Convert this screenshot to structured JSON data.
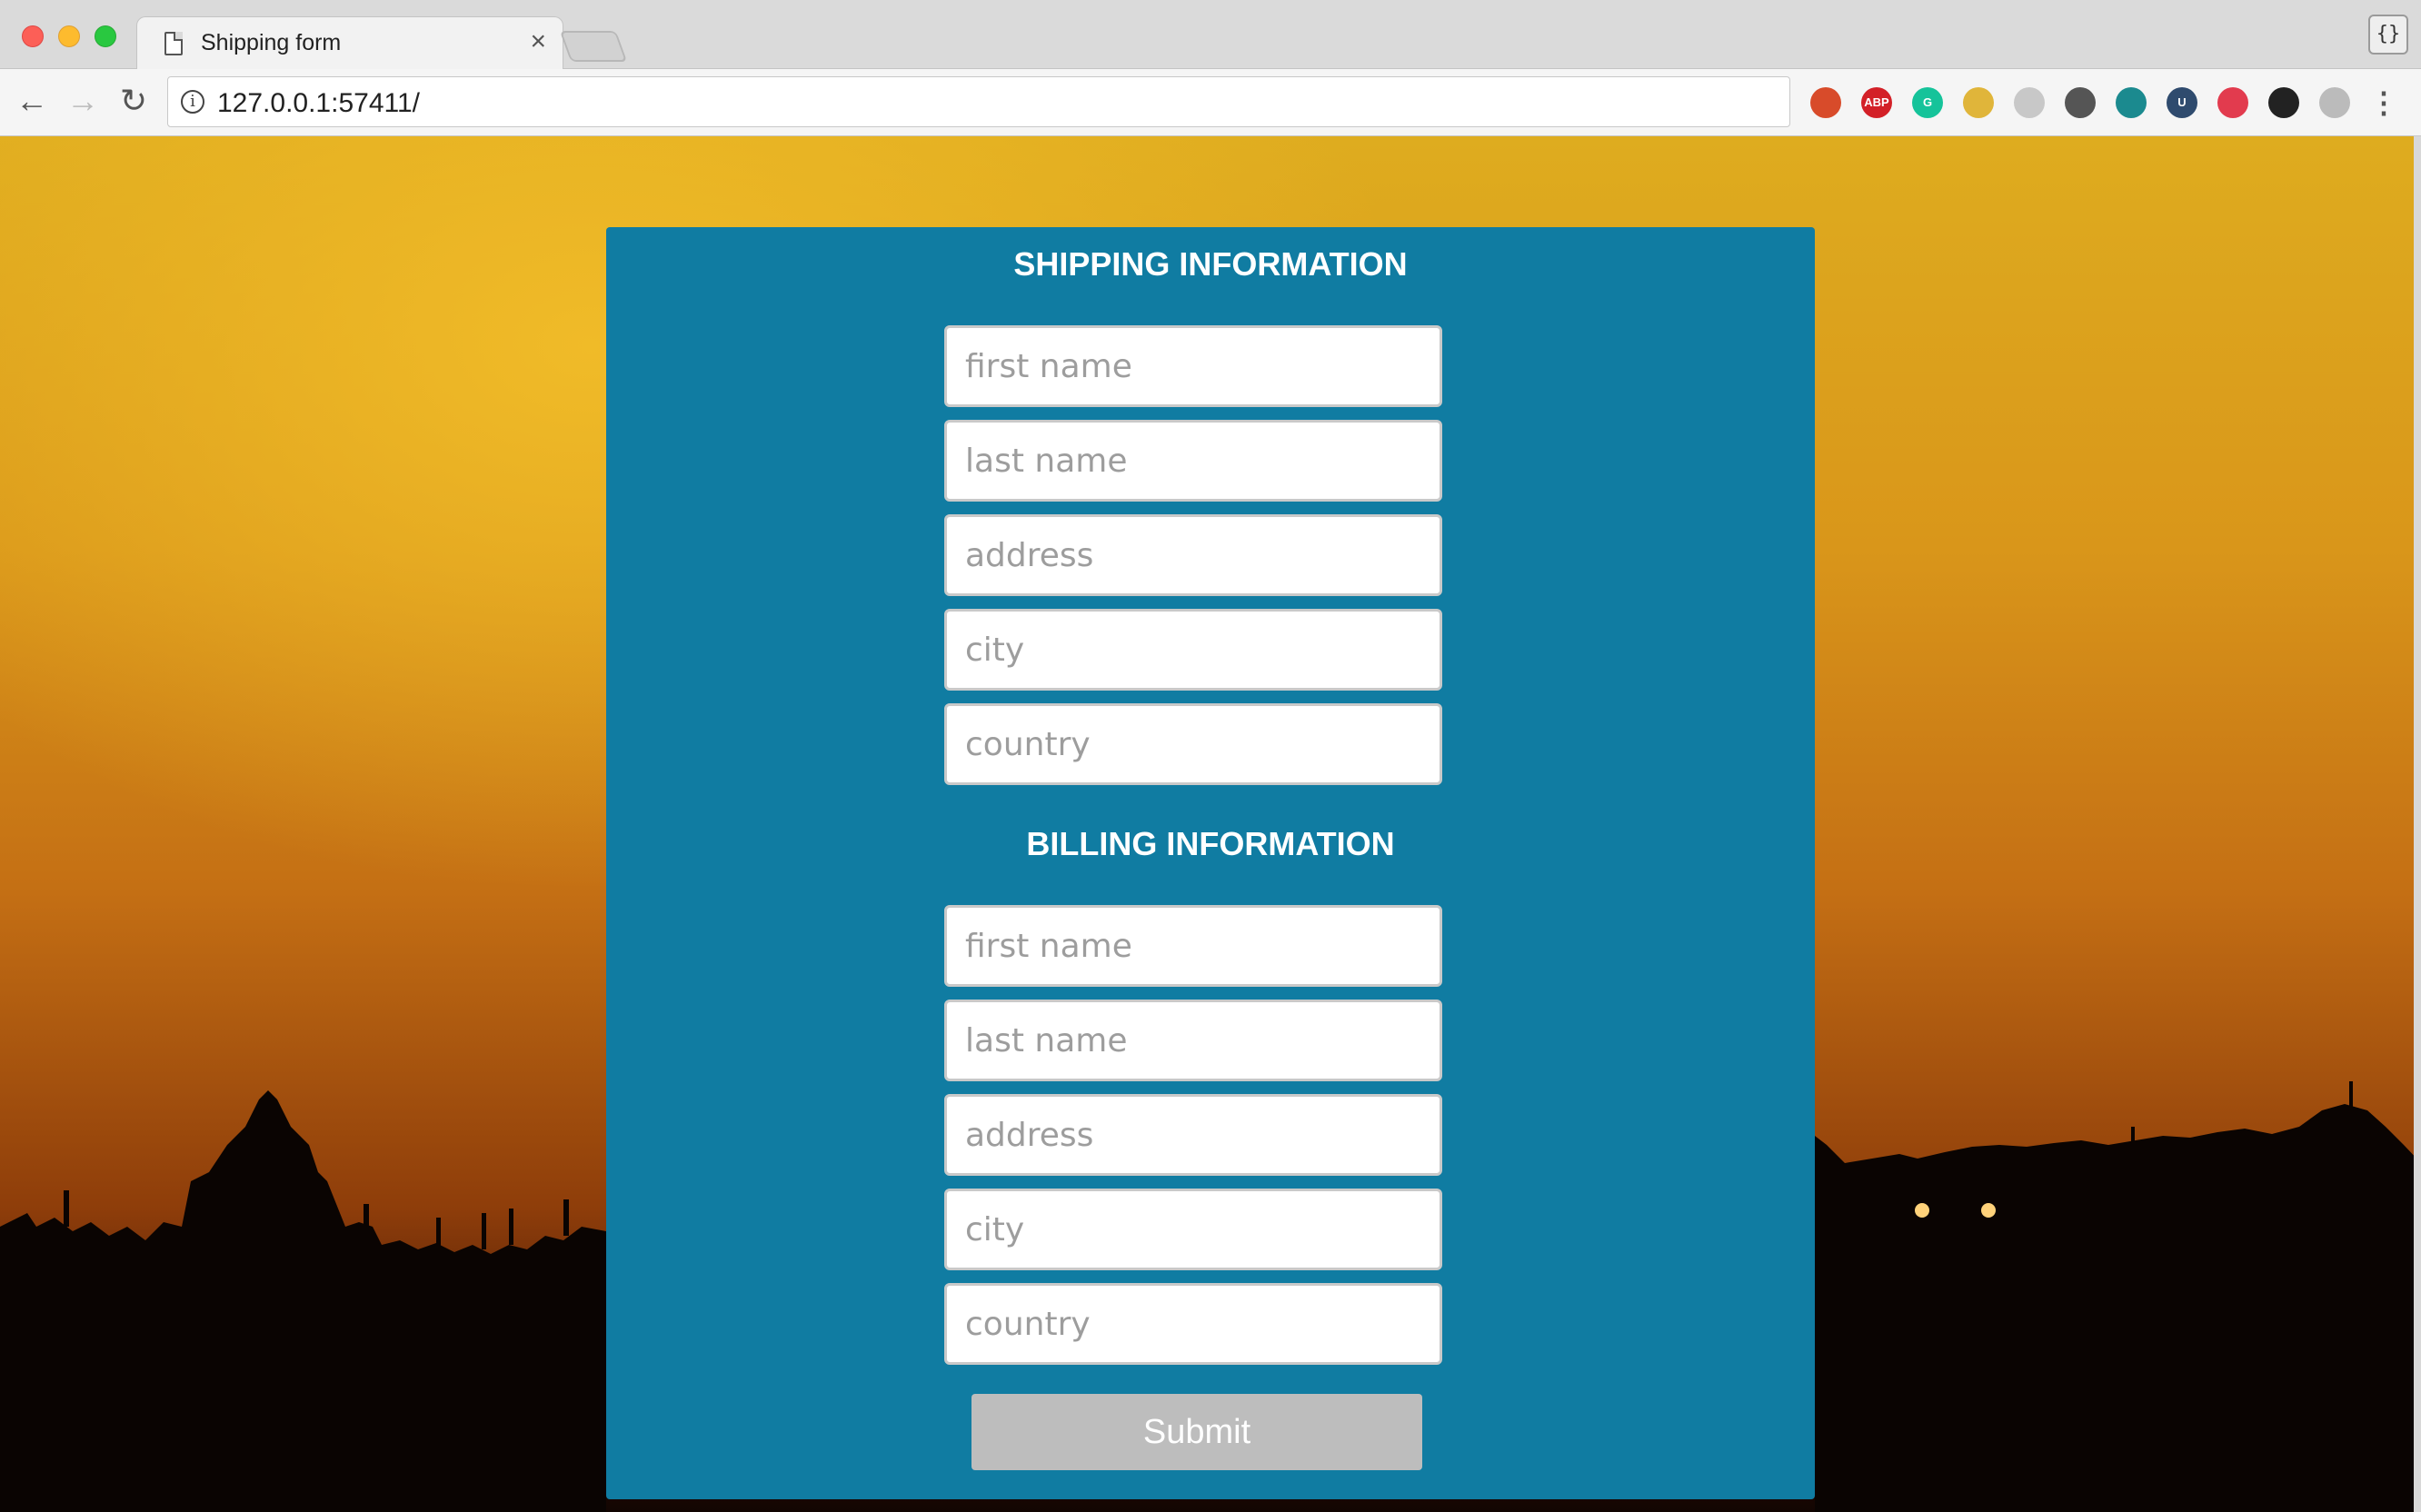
{
  "browser": {
    "tab_title": "Shipping form",
    "tab_close": "×",
    "url": "127.0.0.1:57411/",
    "devtools_label": "{}",
    "extensions": [
      {
        "name": "bookmark-ext-icon",
        "label": "",
        "color": "#d84b2a"
      },
      {
        "name": "adblock-plus-icon",
        "label": "ABP",
        "color": "#d32027"
      },
      {
        "name": "grammarly-icon",
        "label": "G",
        "color": "#15c39a"
      },
      {
        "name": "ruler-ext-icon",
        "label": "",
        "color": "#e0b53a"
      },
      {
        "name": "circle-ext-icon",
        "label": "",
        "color": "#c8c8c8"
      },
      {
        "name": "pocket-icon",
        "label": "",
        "color": "#555555"
      },
      {
        "name": "teal-ext-icon",
        "label": "",
        "color": "#1b8a8f"
      },
      {
        "name": "u-ext-icon",
        "label": "U",
        "color": "#2f4b6e"
      },
      {
        "name": "red-ext-icon",
        "label": "",
        "color": "#e23b4e"
      },
      {
        "name": "sync-ext-icon",
        "label": "",
        "color": "#222222"
      },
      {
        "name": "vue-devtools-icon",
        "label": "",
        "color": "#bbbbbb"
      }
    ]
  },
  "form": {
    "shipping_title": "SHIPPING INFORMATION",
    "billing_title": "BILLING INFORMATION",
    "shipping": {
      "first_name": "first name",
      "last_name": "last name",
      "address": "address",
      "city": "city",
      "country": "country"
    },
    "billing": {
      "first_name": "first name",
      "last_name": "last name",
      "address": "address",
      "city": "city",
      "country": "country"
    },
    "submit_label": "Submit"
  },
  "colors": {
    "panel": "#107ca2",
    "submit_bg": "#bdbdbd"
  }
}
